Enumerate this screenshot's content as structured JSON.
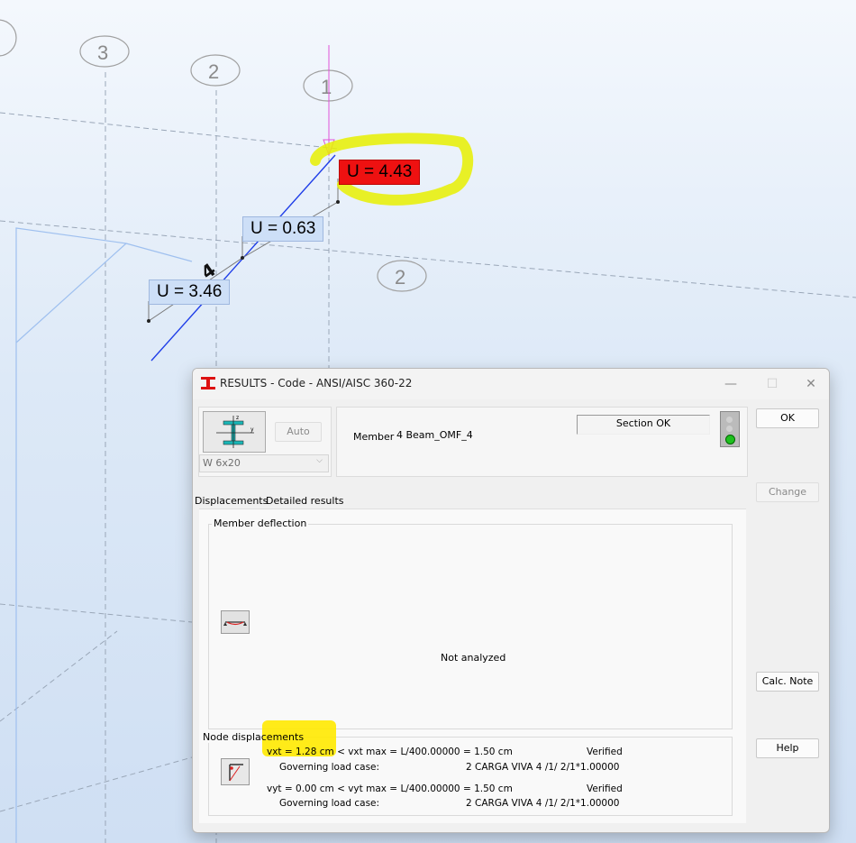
{
  "viewport": {
    "axis_labels": [
      "3",
      "2",
      "1",
      "2"
    ],
    "utilization_labels": [
      {
        "text": "U = 4.43",
        "status": "fail"
      },
      {
        "text": "U = 0.63",
        "status": "ok"
      },
      {
        "text": "U = 3.46",
        "status": "ok"
      }
    ],
    "member_number": "4"
  },
  "dialog": {
    "title": "RESULTS - Code - ANSI/AISC 360-22",
    "auto_label": "Auto",
    "section_value": "W 6x20",
    "member_label": "Member",
    "member_value": "4  Beam_OMF_4",
    "status_text": "Section OK",
    "buttons": {
      "ok": "OK",
      "change": "Change",
      "calc_note": "Calc. Note",
      "help": "Help"
    },
    "tabs": [
      "Displacements",
      "Detailed results"
    ],
    "member_deflection": {
      "title": "Member deflection",
      "status": "Not analyzed"
    },
    "node_displacements": {
      "title": "Node displacements",
      "rows": [
        {
          "check": "vxt = 1.28 cm  <  vxt max = L/400.00000 = 1.50 cm",
          "result": "Verified",
          "case_label": "Governing load case:",
          "case": "2 CARGA VIVA 4 /1/  2/1*1.00000"
        },
        {
          "check": "vyt = 0.00 cm  <  vyt max = L/400.00000 = 1.50 cm",
          "result": "Verified",
          "case_label": "Governing load case:",
          "case": "2 CARGA VIVA 4 /1/  2/1*1.00000"
        }
      ]
    }
  },
  "colors": {
    "fail": "#ee1111",
    "ok_label": "#cddff7",
    "highlight": "#ffe900",
    "member_line": "#1f3ee8"
  }
}
